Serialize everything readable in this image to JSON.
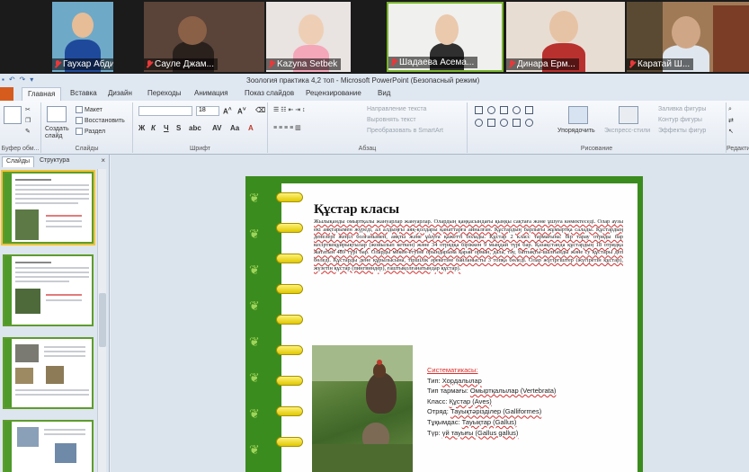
{
  "participants": [
    {
      "name": "Гаухар Абди..."
    },
    {
      "name": "Сауле Джам..."
    },
    {
      "name": "Kazyna Setbek"
    },
    {
      "name": "Шадаева Асема..."
    },
    {
      "name": "Динара Ерм..."
    },
    {
      "name": "Каратай Ш..."
    }
  ],
  "window": {
    "title": "Зоология практика 4,2 топ  -  Microsoft PowerPoint (Безопасный режим)"
  },
  "tabs": [
    "Главная",
    "Вставка",
    "Дизайн",
    "Переходы",
    "Анимация",
    "Показ слайдов",
    "Рецензирование",
    "Вид"
  ],
  "active_tab": "Главная",
  "ribbon": {
    "clipboard_label": "Буфер обм...",
    "slides": {
      "create": "Создать слайд",
      "layout": "Макет",
      "reset": "Восстановить",
      "section": "Раздел",
      "label": "Слайды"
    },
    "font_label": "Шрифт",
    "font_size": "18",
    "paragraph": {
      "direction": "Направление текста",
      "align": "Выровнять текст",
      "smartart": "Преобразовать в SmartArt",
      "label": "Абзац"
    },
    "drawing": {
      "arrange": "Упорядочить",
      "quick_styles": "Экспресс-стили",
      "fill": "Заливка фигуры",
      "outline": "Контур фигуры",
      "effects": "Эффекты фигур",
      "label": "Рисование"
    },
    "editing_label": "Редакти..."
  },
  "panel": {
    "tab_slides": "Слайды",
    "tab_outline": "Структура",
    "close": "×"
  },
  "slide": {
    "title": "Құстар класы",
    "paragraph": "Жылықанды омыртқалы жануарлар жануарлар. Олардың қаңқасындағы қыңқы сақтаға және ұшуға көмектеседі. Олар аузы екі аяқтарымен жүреді, ал алдыңғы аяқ-қолдары қанаттарға айналған. Құстардың барлығы жұмыртқа салады. Құстардың денелері жеңіл болғанымен, аяқты және ұшуға қажетті болады. Құстар 2 класс тармағына: бір тарау отряды бар кесірткеқұйрықтылар (жойылып кеткен) және 34 отрядқа біріккен 9 мыңдай түрі бар. Қазақстанда құстардың 18 отрядқа жататын 489 түрі бар. Оларды мекен-етуіне орындарына қарай орман, дала, тау, батпақты-шалғынды және су құстары деп бөледі. Құстарды дене құрылысына, тіршілік әрекетіне байланысты 3 топқа бөледі. Олар жүгіргіштер (жүгіретін құстар), жүзетін құстар (пингвиндер), ғаштықолғанатындар құстар).",
    "taxonomy_heading": "Систематикасы:",
    "taxonomy": [
      {
        "rank": "Тип:",
        "value": "Хордалылар"
      },
      {
        "rank": "Тип тармағы:",
        "value": "Омыртқалылар (Vertebrata)"
      },
      {
        "rank": "Класс:",
        "value": "Құстар (Aves)"
      },
      {
        "rank": "Отряд:",
        "value": "Тауықтәрізділер (Galliformes)"
      },
      {
        "rank": "Тұқымдас:",
        "value": "Тауықтар (Gallus)"
      },
      {
        "rank": "Түр:",
        "value": "үй тауығы (Gallus gallus)"
      }
    ]
  },
  "colors": {
    "slide_green": "#3b8c1e",
    "ring_yellow": "#f2e028",
    "accent_red": "#d9302c",
    "file_tab": "#d65c1e"
  }
}
